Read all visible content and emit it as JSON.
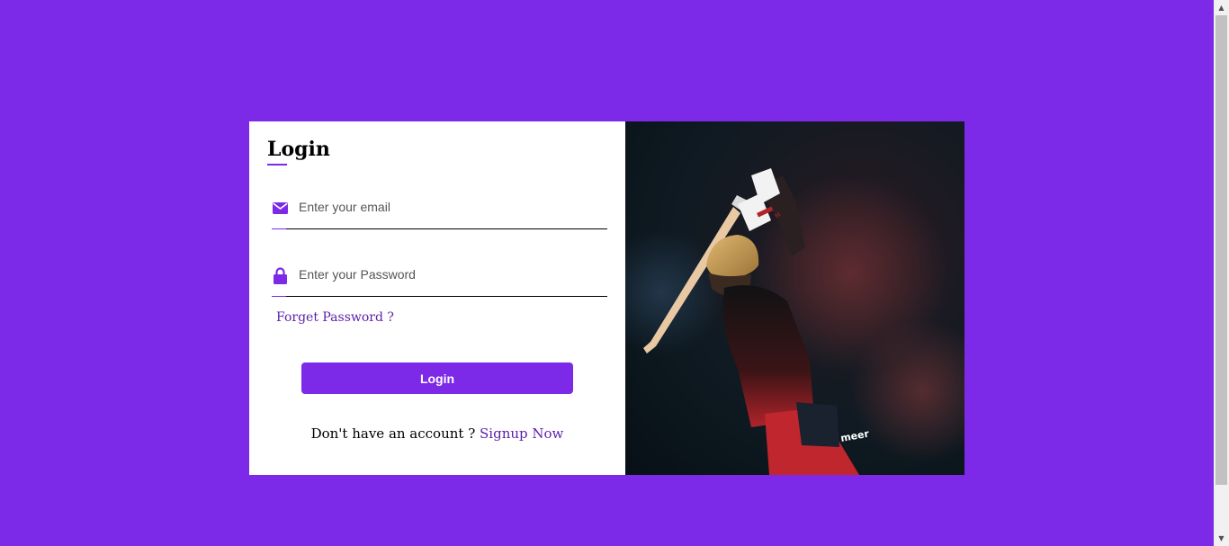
{
  "form": {
    "title": "Login",
    "email_placeholder": "Enter your email",
    "password_placeholder": "Enter your Password",
    "forgot_label": "Forget Password ?",
    "login_button": "Login",
    "signup_prompt": "Don't have an account ?",
    "signup_link": "Signup Now"
  },
  "icons": {
    "email": "envelope-icon",
    "password": "lock-icon"
  },
  "colors": {
    "accent": "#7d2ae8",
    "link": "#5b1fa8"
  }
}
